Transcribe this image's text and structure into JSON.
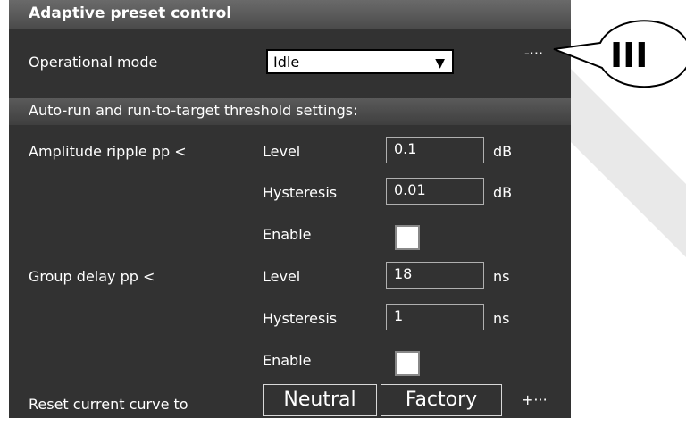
{
  "header": {
    "title": "Adaptive preset control"
  },
  "operational_mode": {
    "label": "Operational mode",
    "value": "Idle",
    "more": "-···"
  },
  "section": {
    "title": "Auto-run and run-to-target threshold settings:"
  },
  "amplitude": {
    "label": "Amplitude ripple pp <",
    "level_label": "Level",
    "level_value": "0.1",
    "level_unit": "dB",
    "hyst_label": "Hysteresis",
    "hyst_value": "0.01",
    "hyst_unit": "dB",
    "enable_label": "Enable"
  },
  "group_delay": {
    "label": "Group delay pp <",
    "level_label": "Level",
    "level_value": "18",
    "level_unit": "ns",
    "hyst_label": "Hysteresis",
    "hyst_value": "1",
    "hyst_unit": "ns",
    "enable_label": "Enable"
  },
  "reset": {
    "label": "Reset current curve to",
    "neutral": "Neutral",
    "factory": "Factory",
    "more": "+···"
  },
  "callout": {
    "text": "III"
  },
  "colors": {
    "panel": "#323232",
    "header": "#5a5a5a",
    "text": "#ffffff"
  }
}
